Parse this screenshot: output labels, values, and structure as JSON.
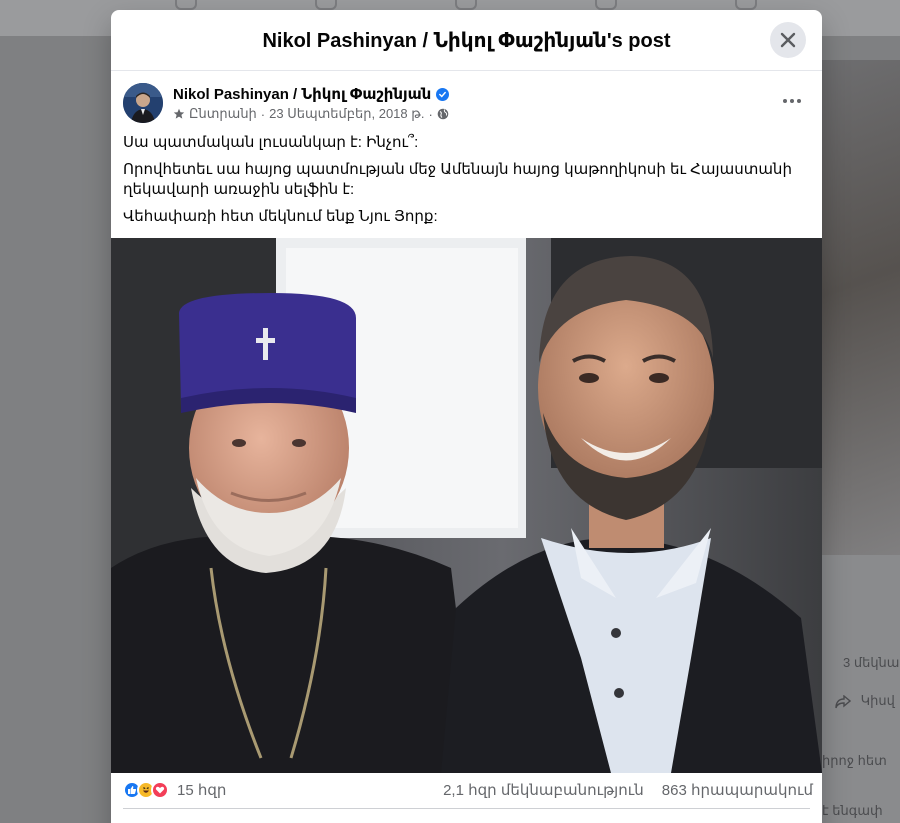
{
  "modal": {
    "title": "Nikol Pashinyan / Նիկոլ Փաշինյան's post",
    "close_icon": "close-icon"
  },
  "post": {
    "author": "Nikol Pashinyan / Նիկոլ Փաշինյան",
    "verified_icon": "verified-badge-icon",
    "favorites_icon": "star-icon",
    "favorites_label": "Ընտրանի",
    "date": "23 Սեպտեմբեր, 2018 թ.",
    "audience_icon": "globe-icon",
    "paragraphs": [
      "Սա պատմական լուսանկար է: Ինչու՞:",
      "Որովհետեւ սա հայոց պատմության մեջ Ամենայն հայոց կաթողիկոսի եւ Հայաստանի ղեկավարի առաջին սելֆին է:",
      "Վեհափառի հետ մեկնում ենք Նյու Յորք:"
    ]
  },
  "stats": {
    "reactions": [
      "like",
      "haha",
      "love"
    ],
    "reaction_count": "15 հզր",
    "comments": "2,1 հզր մեկնաբանություն",
    "shares": "863 հրապարակում"
  },
  "background": {
    "snippets": [
      "3 մեկնա",
      "Կիսվ",
      "իրոջ հետ",
      "է ենգափ"
    ]
  },
  "colors": {
    "accent": "#1877f2",
    "overlay": "#8c8d8f",
    "text_secondary": "#65676b"
  }
}
